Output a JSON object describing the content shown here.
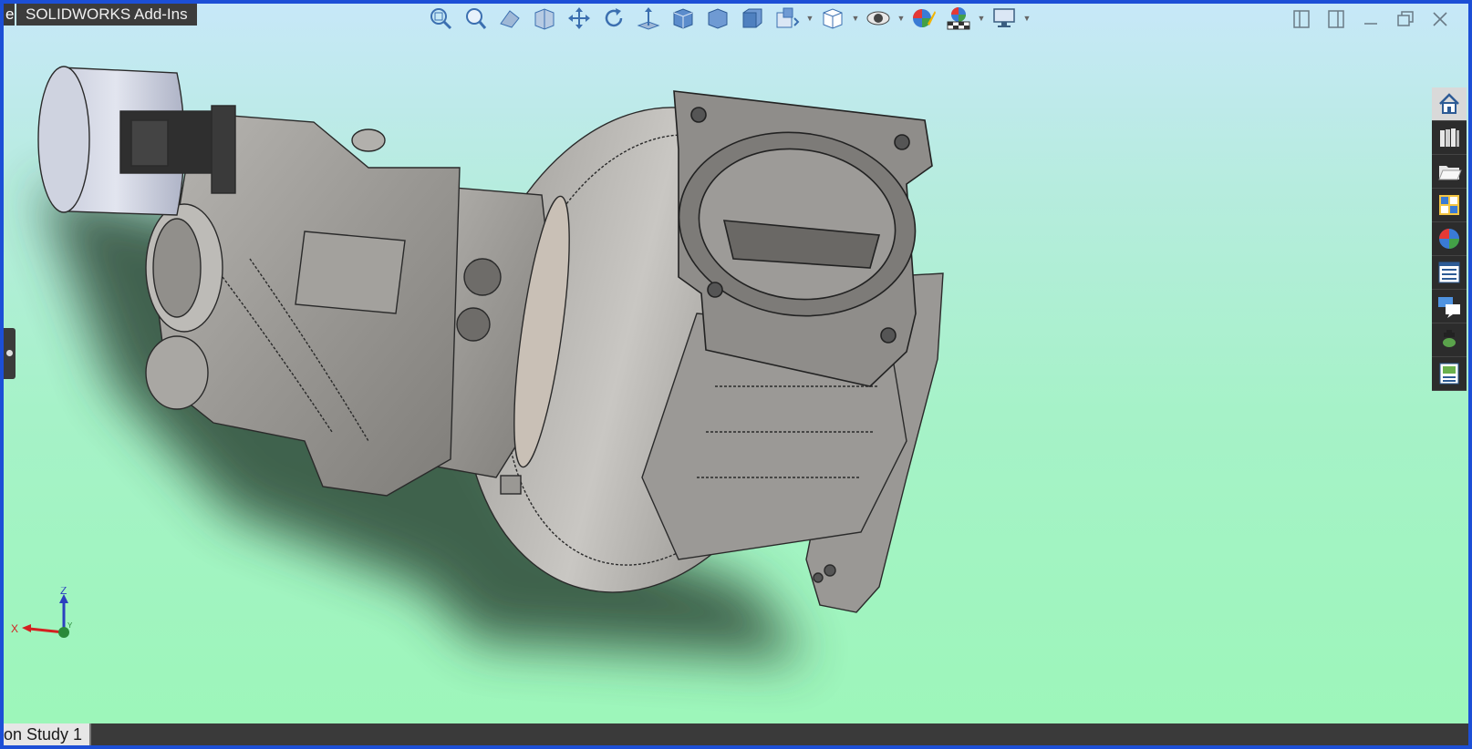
{
  "tabs": {
    "stub": "e",
    "addins": "SOLIDWORKS Add-Ins"
  },
  "hud": {
    "icons": [
      "zoom-to-fit-icon",
      "zoom-to-area-icon",
      "previous-view-icon",
      "section-view-icon",
      "pan-icon",
      "rotate-icon",
      "normal-to-icon",
      "isometric-view-icon",
      "front-view-icon",
      "shaded-cube-icon",
      "view-orientation-icon",
      "display-style-icon",
      "hide-show-items-icon",
      "edit-appearance-icon",
      "apply-scene-icon",
      "view-settings-icon"
    ]
  },
  "taskpane": [
    "home-icon",
    "design-library-icon",
    "file-explorer-icon",
    "view-palette-icon",
    "appearances-icon",
    "custom-properties-icon",
    "forum-icon",
    "add-in-icon",
    "tasks-icon"
  ],
  "triad": {
    "x": "X",
    "y": "Y",
    "z": "Z"
  },
  "status": {
    "study_tab": "on Study 1"
  },
  "colors": {
    "border": "#1c4fd6",
    "background_top": "#c7e8f8",
    "background_bottom": "#9cf6b9",
    "model": "#8d8b88"
  }
}
